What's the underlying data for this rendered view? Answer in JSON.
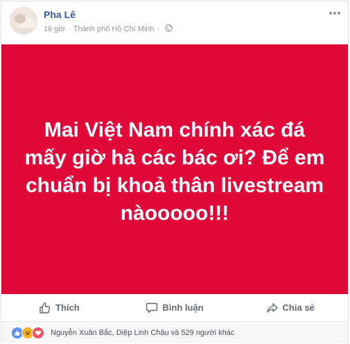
{
  "post": {
    "author": "Pha Lê",
    "time": "16 giờ",
    "separator": "·",
    "location": "Thành phố Hồ Chí Minh",
    "image_text": "Mai Việt Nam chính xác đá mấy giờ hả các bác ơi? Để em chuẩn bị khoả thân livestream nàooooo!!!",
    "background_color": "#e0093a"
  },
  "actions": {
    "like_label": "Thích",
    "comment_label": "Bình luận",
    "share_label": "Chia sẻ"
  },
  "reactions": {
    "icons": [
      "like-icon",
      "haha-icon",
      "love-icon"
    ],
    "summary": "Nguyễn Xuân Bắc, Diệp Linh Châu và 529 người khác"
  }
}
